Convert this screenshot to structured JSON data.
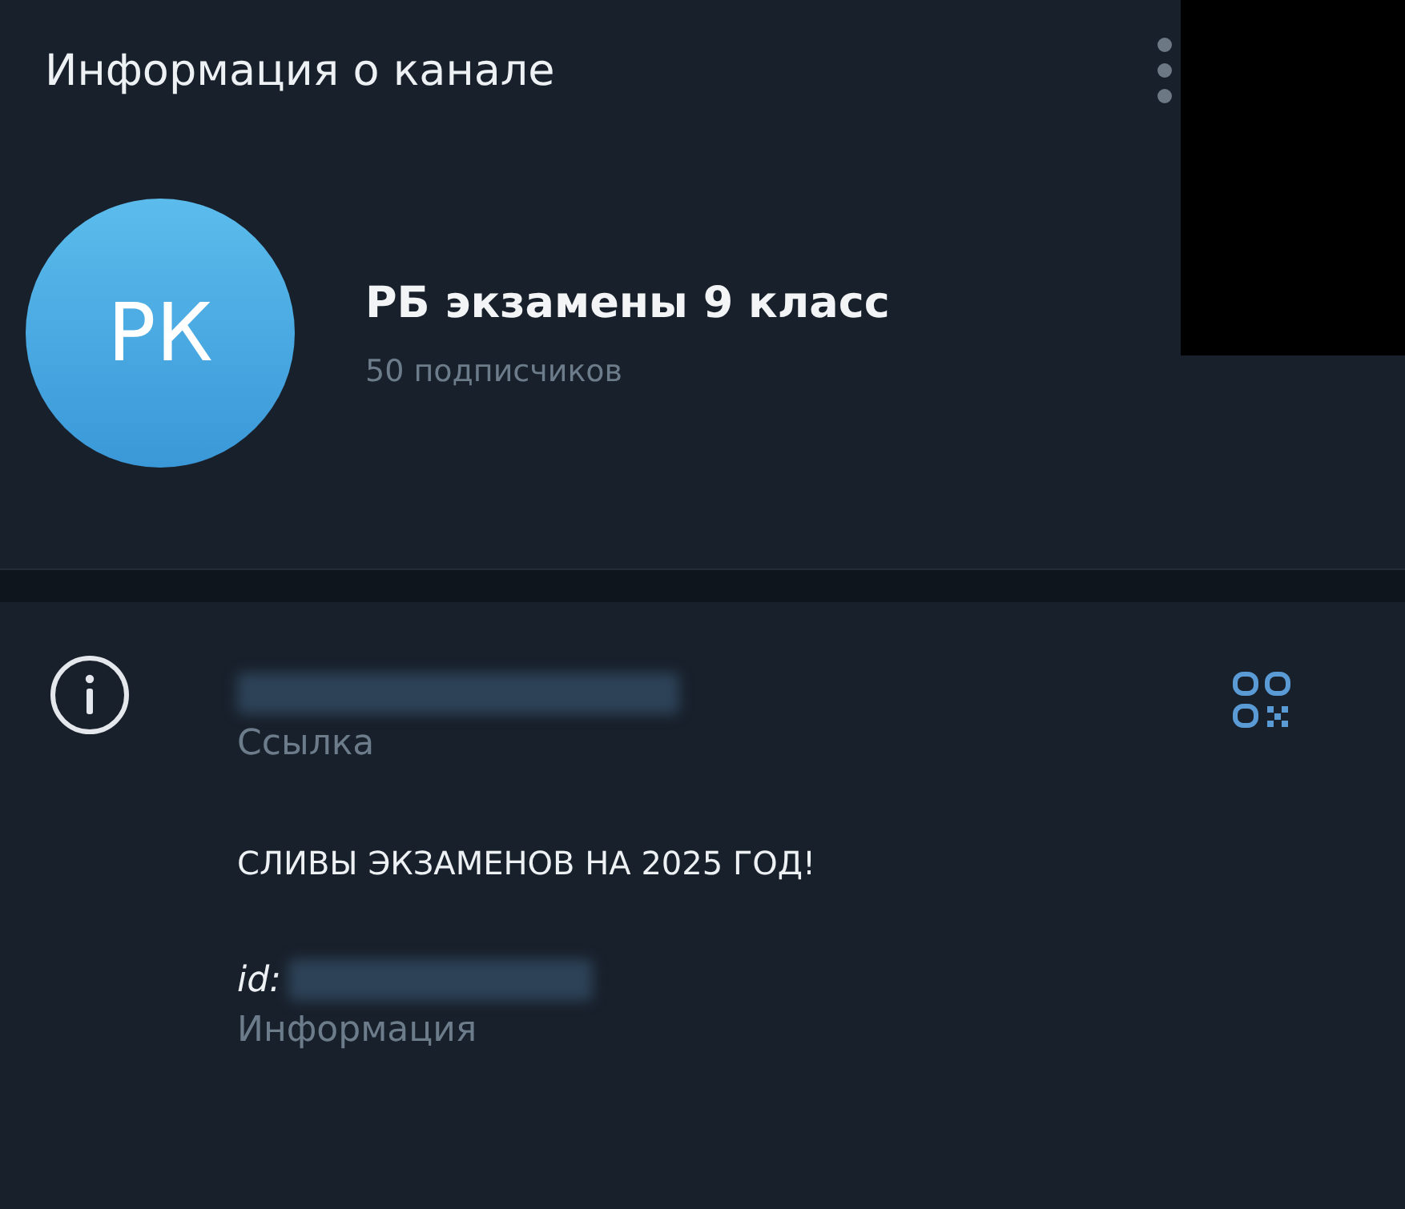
{
  "header": {
    "title": "Информация о канале"
  },
  "channel": {
    "initials": "РК",
    "name": "РБ экзамены 9 класс",
    "subscribers": "50 подписчиков"
  },
  "info": {
    "link_label": "Ссылка",
    "description": "СЛИВЫ ЭКЗАМЕНОВ НА 2025 ГОД!",
    "id_label": "id:",
    "info_label": "Информация"
  }
}
